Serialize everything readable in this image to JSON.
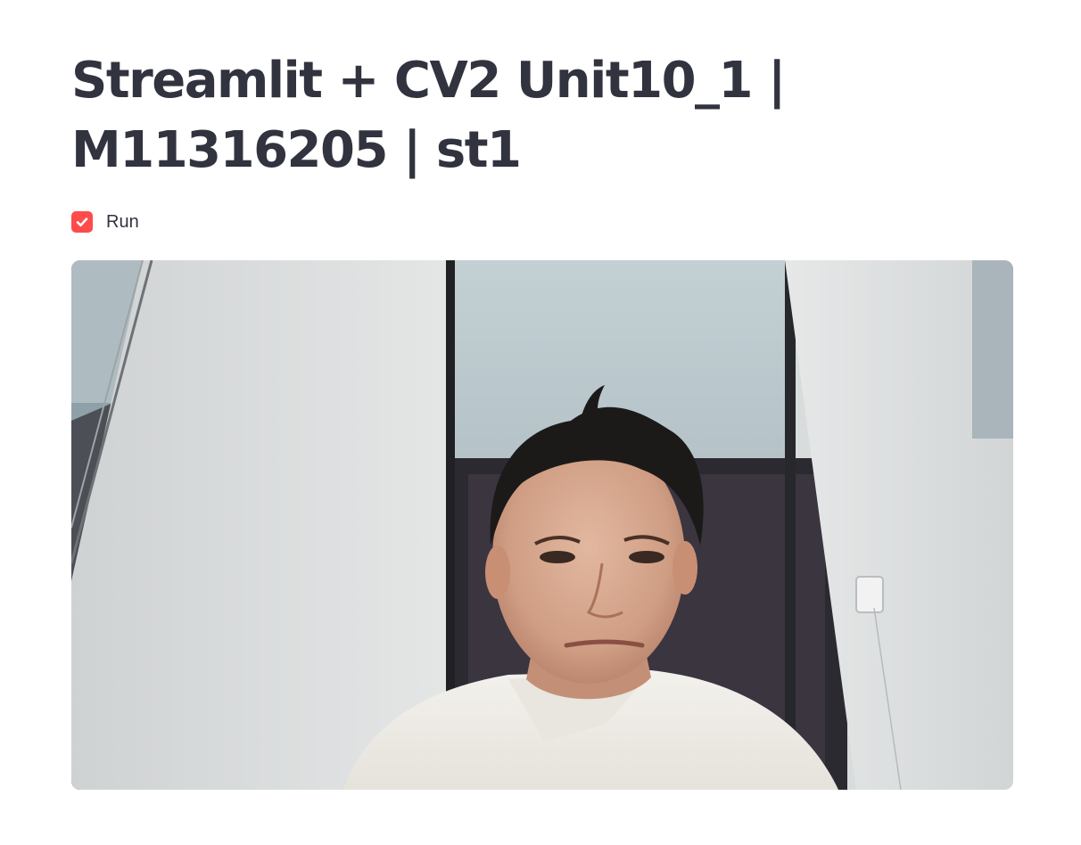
{
  "page": {
    "title": "Streamlit + CV2 Unit10_1 | M11316205 | st1"
  },
  "run_checkbox": {
    "label": "Run",
    "checked": true,
    "accent_color": "#ff4b4b"
  },
  "video_frame": {
    "content": "webcam-frame"
  },
  "icons": {
    "checkbox": "check-icon"
  }
}
